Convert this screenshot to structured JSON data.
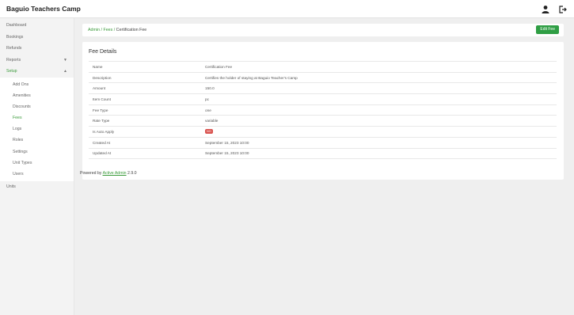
{
  "header": {
    "brand": "Baguio Teachers Camp"
  },
  "sidebar": {
    "items": [
      {
        "label": "Dashboard"
      },
      {
        "label": "Bookings"
      },
      {
        "label": "Refunds"
      },
      {
        "label": "Reports"
      },
      {
        "label": "Setup",
        "active": true
      }
    ],
    "setup_children": [
      "Add Ons",
      "Amenities",
      "Discounts",
      "Fees",
      "Logs",
      "Roles",
      "Settings",
      "Unit Types",
      "Users"
    ],
    "after": "Units"
  },
  "breadcrumb": {
    "admin": "Admin",
    "fees": "Fees",
    "current": "Certification Fee"
  },
  "actions": {
    "edit_label": "Edit Fee"
  },
  "panel": {
    "title": "Fee Details",
    "rows": [
      {
        "key": "Name",
        "value": "Certification Fee"
      },
      {
        "key": "Description",
        "value": "Certifies the holder of staying at Baguio Teacher's Camp"
      },
      {
        "key": "Amount",
        "value": "150.0"
      },
      {
        "key": "Item Count",
        "value": "pc"
      },
      {
        "key": "Fee Type",
        "value": "one"
      },
      {
        "key": "Rate Type",
        "value": "variable"
      },
      {
        "key": "Is Auto Apply",
        "value": "NO"
      },
      {
        "key": "Created At",
        "value": "September 15, 2023 10:00"
      },
      {
        "key": "Updated At",
        "value": "September 15, 2023 10:00"
      }
    ]
  },
  "footer": {
    "text": "Powered by ",
    "link": "Active Admin",
    "version": " 2.9.0"
  },
  "colors": {
    "accent": "#2f9e44",
    "link": "#3b9b3b",
    "badge": "#d9534f"
  }
}
